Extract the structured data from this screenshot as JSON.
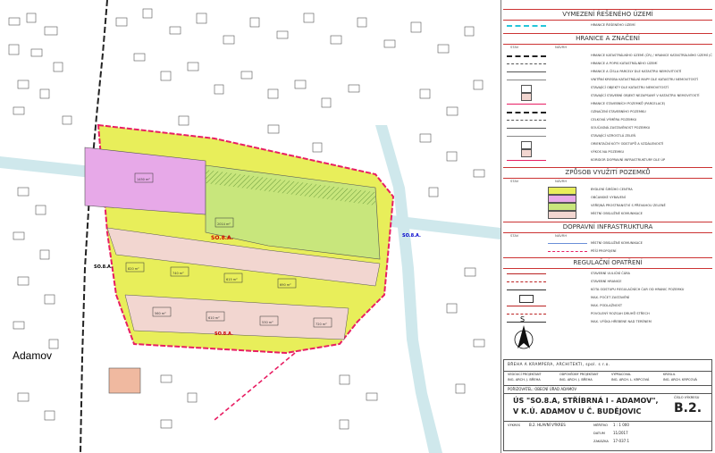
{
  "map": {
    "place_label": "Adamov",
    "area_labels": [
      "SO.8.A.",
      "SO.8.A.",
      "SO.8.A.",
      "SO.8.A."
    ],
    "parcel_numbers": [
      "1450 m²",
      "2014 m²",
      "820 m²",
      "740 m²",
      "615 m²",
      "690 m²",
      "560 m²",
      "610 m²",
      "530 m²",
      "720 m²"
    ],
    "colors": {
      "pink": "#e7a9e8",
      "yellow": "#e8ee5a",
      "green": "#c8e67c",
      "road": "#cfe8ec",
      "boundary": "#e81e63",
      "line": "#333333"
    }
  },
  "legend": {
    "sections": {
      "vymezeni": "VYMEZENÍ ŘEŠENÉHO ÚZEMÍ",
      "hranice": "HRANICE A ZNAČENÍ",
      "zpusob": "ZPŮSOB VYUŽITÍ POZEMKŮ",
      "doprava": "DOPRAVNÍ INFRASTRUKTURA",
      "regulacni": "REGULAČNÍ OPATŘENÍ"
    },
    "col_stav": "STAV",
    "col_navrh": "NÁVRH",
    "vymezeni_rows": [
      "HRANICE ŘEŠENÉHO ÚZEMÍ"
    ],
    "hranice_rows": [
      "HRANICE KATASTRÁLNÍHO ÚZEMÍ (ČR) / HRANICE KATASTRÁLNÍHO ÚZEMÍ (ČR) + POPIS",
      "HRANICE A POPIS KATASTRÁLNÍHO ÚZEMÍ",
      "HRANICE A ČÍSLA PARCELY DLE KATASTRU NEMOVITOSTÍ",
      "VNITŘNÍ KRESBA KATASTRÁLNÍ MAPY DLE KATASTRU NEMOVITOSTÍ",
      "STAVAJÍCÍ OBJEKTY DLE KATASTRU NEMOVITOSTÍ",
      "STAVAJÍCÍ STAVEBNÍ OBJEKT NEZAPSANÝ V KATASTRU NEMOVITOSTÍ",
      "HRANICE STAVEBNÍCH POZEMKŮ (PARCELACE)",
      "OZNAČENÍ STAVEBNÍHO POZEMKU",
      "CELKOVÁ VÝMĚRA POZEMKU",
      "SOUČASNÁ ZASTAVĚNOST POZEMKU",
      "STAVAJÍCÍ VZROSTLÁ ZELEŇ",
      "ORIENTAČNÍ KÓTY ODSTUPŮ A VZDÁLENOSTÍ",
      "VÝKOS NA POZEMKU",
      "KORIDOR DOPRAVNÍ INFRASTRUKTURY DLE ÚP"
    ],
    "zpusob_rows": [
      "BYDLENÍ ŠIRŠÍHO CENTRA",
      "OBČANSKÉ VYBAVENÍ",
      "VEŘEJNÁ PROSTRANSTVÍ S PŘEVAHOU ZELENĚ",
      "MÍSTNÍ OBSLUŽNÉ KOMUNIKACE"
    ],
    "doprava_rows": [
      "MÍSTNÍ OBSLUŽNÉ KOMUNIKACE",
      "PĚŠÍ PROPOJENÍ"
    ],
    "regulacni_rows": [
      "STAVEBNÍ UULIČNÍ ČÁRA",
      "STAVEBNÍ HRANICE",
      "KÓTA ODSTUPU REGULAČNÍCH ČAR OD HRANIC POZEMKU",
      "MAX. POČET ZASTAVĚNÍ",
      "MAX. PODLAŽNOST",
      "POVOLENÝ ROZSAH DRUHŮ STŘECH",
      "MAX. VÝŠKA HŘEBENE NAD TERÉNEM"
    ],
    "north_label": "S"
  },
  "titleblock": {
    "office": "BŘEHA A KRAMPERA, ARCHITEKTI, spol. s r.o.",
    "roles": [
      "VEDOUCÍ PROJEKTANT",
      "ODPOVĚDNÝ PROJEKTANT",
      "VYPRACOVAL",
      "KRESLIL"
    ],
    "names": [
      "ING. ARCH. J. BŘEHA",
      "ING. ARCH. J. BŘEHA",
      "ING. ARCH. L. KRPCOVÁ",
      "ING. ARCH. KRPCOVÁ"
    ],
    "client": "POŘIZOVATEL: OBECNÍ ÚŘAD ADAMOV",
    "project_line1": "ÚS \"SO.8.A, STŘÍBRNÁ I - ADAMOV\",",
    "project_line2": "V K.Ú. ADAMOV U Č. BUDĚJOVIC",
    "drawing_label": "VÝKRES",
    "drawing_name": "B.2. HLAVNÍ VÝKRES",
    "scale_label": "MĚŘÍTKO",
    "scale": "1 : 1 000",
    "date_label": "DATUM",
    "date": "11/2017",
    "sheet_label": "ČÍSLO VÝKRESU",
    "sheet": "B.2.",
    "job_label": "ZAKÁZKA",
    "job": "17-037.1"
  }
}
